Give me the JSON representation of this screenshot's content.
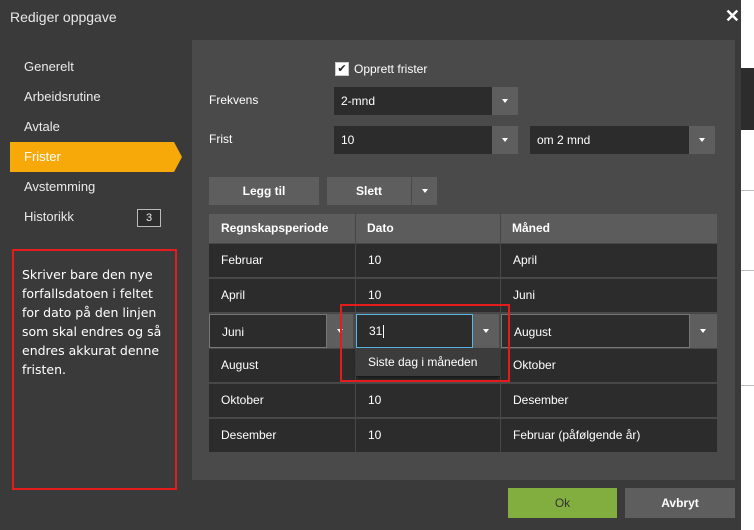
{
  "dialog": {
    "title": "Rediger oppgave",
    "close_glyph": "✕"
  },
  "nav": {
    "items": [
      {
        "label": "Generelt"
      },
      {
        "label": "Arbeidsrutine"
      },
      {
        "label": "Avtale"
      },
      {
        "label": "Frister",
        "active": true
      },
      {
        "label": "Avstemming"
      },
      {
        "label": "Historikk",
        "badge": "3"
      }
    ]
  },
  "note": "Skriver bare den nye forfallsdatoen i feltet for dato på den linjen som skal endres og så endres akkurat denne fristen.",
  "form": {
    "create_deadlines_label": "Opprett frister",
    "create_deadlines_checked": true,
    "check_glyph": "✔",
    "frequency_label": "Frekvens",
    "frequency_value": "2-mnd",
    "deadline_label": "Frist",
    "deadline_day": "10",
    "deadline_offset": "om 2 mnd"
  },
  "toolbar": {
    "add_label": "Legg til",
    "delete_label": "Slett"
  },
  "table": {
    "headers": [
      "Regnskapsperiode",
      "Dato",
      "Måned"
    ],
    "rows": [
      {
        "period": "Februar",
        "date": "10",
        "month": "April"
      },
      {
        "period": "April",
        "date": "10",
        "month": "Juni"
      },
      {
        "period": "Juni",
        "date": "31",
        "month": "August"
      },
      {
        "period": "August",
        "date": "",
        "month": "Oktober"
      },
      {
        "period": "Oktober",
        "date": "10",
        "month": "Desember"
      },
      {
        "period": "Desember",
        "date": "10",
        "month": "Februar (påfølgende år)"
      }
    ]
  },
  "date_popup": {
    "option": "Siste dag i måneden"
  },
  "footer": {
    "ok_label": "Ok",
    "cancel_label": "Avbryt"
  },
  "colors": {
    "accent": "#f7a90a",
    "ok": "#82ad3f",
    "highlight": "#e51c1c",
    "edit_border": "#58b7e6"
  }
}
